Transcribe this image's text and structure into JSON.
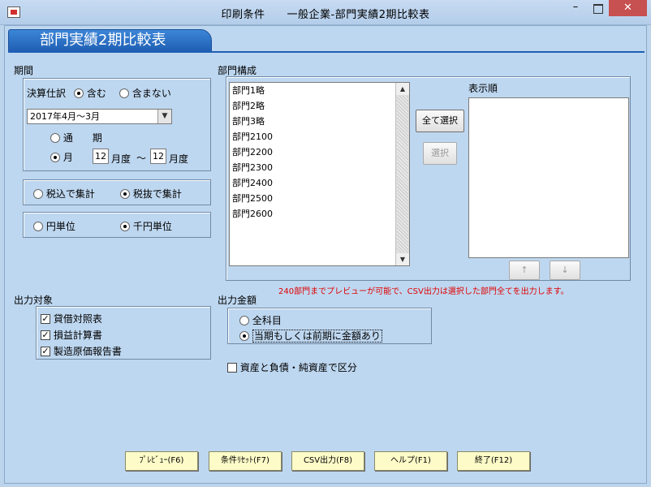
{
  "window": {
    "title": "印刷条件　　一般企業-部門実績2期比較表",
    "minimize": "–",
    "close": "✕",
    "app_icon": "app-icon"
  },
  "report_title": "部門実績2期比較表",
  "period": {
    "label": "期間",
    "closing_label": "決算仕訳",
    "closing_include": "含む",
    "closing_exclude": "含まない",
    "closing_selected": "含む",
    "term_select": "2017年4月～3月",
    "full_period": "通　　期",
    "month": "月",
    "month_from": "12",
    "month_to": "12",
    "month_suffix": "月度",
    "range_sep": "～",
    "month_mode_selected": "月"
  },
  "tax": {
    "incl": "税込で集計",
    "excl": "税抜で集計",
    "selected": "税抜で集計"
  },
  "unit": {
    "yen": "円単位",
    "thousand": "千円単位",
    "selected": "千円単位"
  },
  "departments": {
    "label": "部門構成",
    "items": [
      "部門1略",
      "部門2略",
      "部門3略",
      "部門2100",
      "部門2200",
      "部門2300",
      "部門2400",
      "部門2500",
      "部門2600"
    ],
    "select_all": "全て選択",
    "select": "選択",
    "display_order_label": "表示順",
    "up": "↑",
    "down": "↓",
    "note": "240部門までプレビューが可能で、CSV出力は選択した部門全てを出力します。"
  },
  "output_target": {
    "label": "出力対象",
    "items": [
      {
        "label": "貸借対照表",
        "checked": true
      },
      {
        "label": "損益計算書",
        "checked": true
      },
      {
        "label": "製造原価報告書",
        "checked": true
      }
    ]
  },
  "output_amount": {
    "label": "出力金額",
    "all_accounts": "全科目",
    "with_amount": "当期もしくは前期に金額あり",
    "selected": "当期もしくは前期に金額あり"
  },
  "split_option": {
    "label": "資産と負債・純資産で区分",
    "checked": false
  },
  "footer": {
    "preview": "ﾌﾟﾚﾋﾞｭｰ(F6)",
    "reset": "条件ﾘｾｯﾄ(F7)",
    "csv": "CSV出力(F8)",
    "help": "ヘルプ(F1)",
    "exit": "終了(F12)"
  },
  "colors": {
    "background": "#bed7f0",
    "title_bar": "#1f5fb4",
    "note": "#e00000",
    "footer_button": "#fdfcc8"
  }
}
